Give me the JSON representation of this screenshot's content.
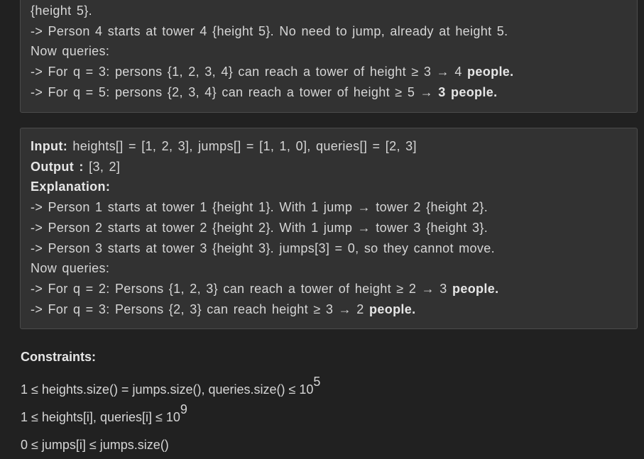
{
  "example1": {
    "lines": [
      "{height 5}.",
      "-> Person 4 starts at tower 4 {height 5}. No need to jump, already at height 5.",
      "Now queries:"
    ],
    "q1_text": "-> For q = 3: persons {1, 2, 3, 4} can reach a tower of height ≥ 3 → 4 ",
    "q1_bold": "people.",
    "q2_text": "-> For q = 5: persons {2, 3, 4} can reach a tower of height ≥ 5 → ",
    "q2_bold": "3 people."
  },
  "example2": {
    "input_label": "Input:",
    "input_value": " heights[] = [1, 2, 3], jumps[] =  [1, 1, 0], queries[] = [2, 3]",
    "output_label": "Output :",
    "output_value": " [3, 2]",
    "explanation_label": "Explanation:",
    "lines": [
      "-> Person 1 starts at tower 1 {height 1}. With 1 jump → tower 2 {height 2}.",
      "-> Person 2 starts at tower 2 {height 2}. With 1 jump → tower 3 {height 3}.",
      "-> Person 3 starts at tower 3 {height 3}. jumps[3] = 0, so they cannot move.",
      "Now queries:"
    ],
    "q1_text": "-> For q = 2: Persons {1, 2, 3} can reach a tower of height ≥ 2 → 3 ",
    "q1_bold": "people.",
    "q2_text": "-> For q = 3: Persons {2, 3} can reach height ≥ 3 → 2 ",
    "q2_bold": "people."
  },
  "constraints": {
    "title": "Constraints:",
    "line1": "1 ≤ heights.size() = jumps.size(),  queries.size() ≤ 10",
    "line1_exp": "5",
    "line2": "1 ≤ heights[i], queries[i] ≤ 10",
    "line2_exp": "9",
    "line3": "0 ≤ jumps[i] ≤ jumps.size()"
  }
}
